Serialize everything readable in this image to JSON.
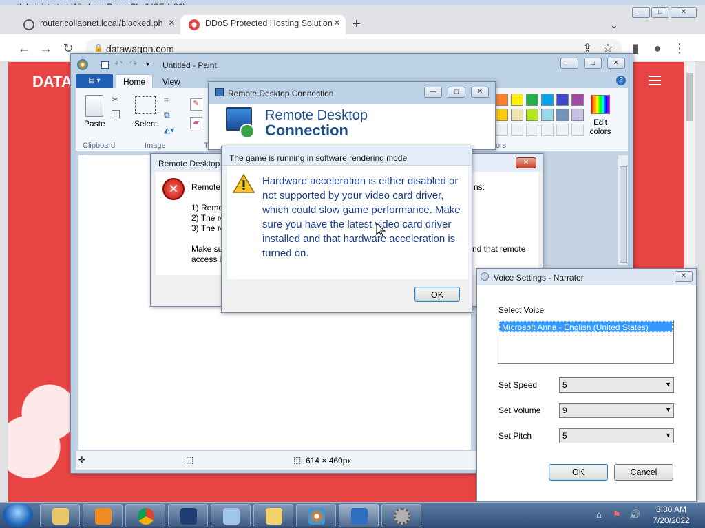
{
  "powershell": {
    "title": "Administrator: Windows PowerShell ISE (x86)"
  },
  "browser": {
    "tabs": [
      {
        "label": "router.collabnet.local/blocked.ph"
      },
      {
        "label": "DDoS Protected Hosting Solution"
      }
    ],
    "new_tab": "+",
    "url": "datawagon.com",
    "page_logo": "DATA"
  },
  "paint": {
    "title": "Untitled - Paint",
    "tabs": [
      {
        "label": "Home"
      },
      {
        "label": "View"
      }
    ],
    "groups": {
      "clipboard": "Clipboard",
      "image": "Image",
      "colors_partial": "ors"
    },
    "paste": "Paste",
    "select": "Select",
    "edit_colors": "Edit colors",
    "status_size": "614 × 460px",
    "swatches": [
      "#ff7f27",
      "#fff200",
      "#22b14c",
      "#00a2e8",
      "#3f48cc",
      "#a349a4",
      "#ffc90e",
      "#efe4b0",
      "#b5e61d",
      "#99d9ea",
      "#7092be",
      "#c8bfe7"
    ]
  },
  "rdc": {
    "title": "Remote Desktop Connection",
    "heading_line1": "Remote Desktop",
    "heading_line2": "Connection"
  },
  "rd_error": {
    "title": "Remote Desktop",
    "intro": "Remote",
    "intro_right": "ns:",
    "items": [
      "1) Remo",
      "2) The re",
      "3) The re"
    ],
    "make_sure": "Make su",
    "make_sure_right": "nd that remote",
    "access": "access is"
  },
  "game_dialog": {
    "title": "The game is running in software rendering mode",
    "message": "Hardware acceleration is either disabled or not supported by your video card driver, which could slow game performance. Make sure you have the latest video card driver installed and that hardware acceleration is turned on.",
    "ok": "OK"
  },
  "voice": {
    "title": "Voice Settings - Narrator",
    "select_voice_label": "Select Voice",
    "selected_voice": "Microsoft Anna - English (United States)",
    "speed_label": "Set Speed",
    "speed": "5",
    "volume_label": "Set Volume",
    "volume": "9",
    "pitch_label": "Set Pitch",
    "pitch": "5",
    "ok": "OK",
    "cancel": "Cancel"
  },
  "taskbar": {
    "time": "3:30 AM",
    "date": "7/20/2022"
  }
}
